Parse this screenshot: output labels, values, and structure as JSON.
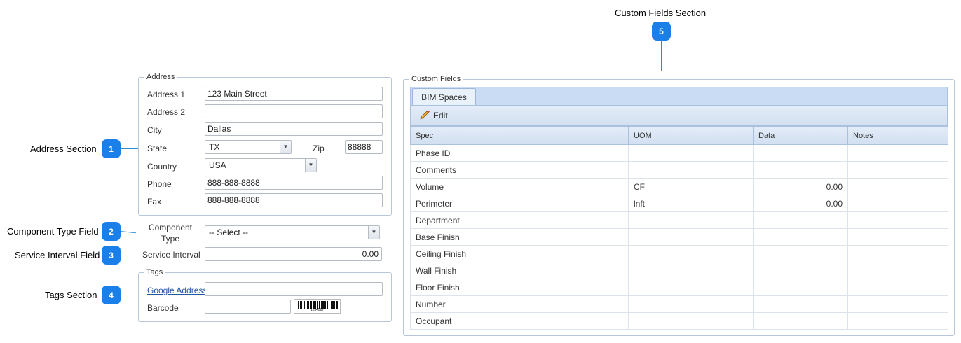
{
  "callouts": [
    {
      "num": "1",
      "label": "Address Section"
    },
    {
      "num": "2",
      "label": "Component Type Field"
    },
    {
      "num": "3",
      "label": "Service Interval Field"
    },
    {
      "num": "4",
      "label": "Tags Section"
    },
    {
      "num": "5",
      "label": "Custom Fields Section"
    }
  ],
  "address": {
    "legend": "Address",
    "address1_label": "Address 1",
    "address1": "123 Main Street",
    "address2_label": "Address 2",
    "address2": "",
    "city_label": "City",
    "city": "Dallas",
    "state_label": "State",
    "state": "TX",
    "zip_label": "Zip",
    "zip": "88888",
    "country_label": "Country",
    "country": "USA",
    "phone_label": "Phone",
    "phone": "888-888-8888",
    "fax_label": "Fax",
    "fax": "888-888-8888"
  },
  "component_type": {
    "label_line1": "Component",
    "label_line2": "Type",
    "value": "-- Select --"
  },
  "service_interval": {
    "label": "Service Interval",
    "value": "0.00"
  },
  "tags": {
    "legend": "Tags",
    "google_address_label": "Google Address",
    "google_address": "",
    "barcode_label": "Barcode",
    "barcode": "",
    "barcode_number": "1234567"
  },
  "custom_fields": {
    "legend": "Custom Fields",
    "tab": "BIM Spaces",
    "edit_label": "Edit",
    "columns": [
      "Spec",
      "UOM",
      "Data",
      "Notes"
    ],
    "rows": [
      [
        "Phase ID",
        "",
        "",
        ""
      ],
      [
        "Comments",
        "",
        "",
        ""
      ],
      [
        "Volume",
        "CF",
        "0.00",
        ""
      ],
      [
        "Perimeter",
        "lnft",
        "0.00",
        ""
      ],
      [
        "Department",
        "",
        "",
        ""
      ],
      [
        "Base Finish",
        "",
        "",
        ""
      ],
      [
        "Ceiling Finish",
        "",
        "",
        ""
      ],
      [
        "Wall Finish",
        "",
        "",
        ""
      ],
      [
        "Floor Finish",
        "",
        "",
        ""
      ],
      [
        "Number",
        "",
        "",
        ""
      ],
      [
        "Occupant",
        "",
        "",
        ""
      ]
    ]
  },
  "icons": {
    "edit": "pencil-icon",
    "dropdown": "chevron-down-icon"
  },
  "colors": {
    "badge": "#1a7fe8",
    "leader": "#2c8fd6",
    "grid_header": "#d1dff1",
    "tabstrip": "#c9dcf3"
  }
}
